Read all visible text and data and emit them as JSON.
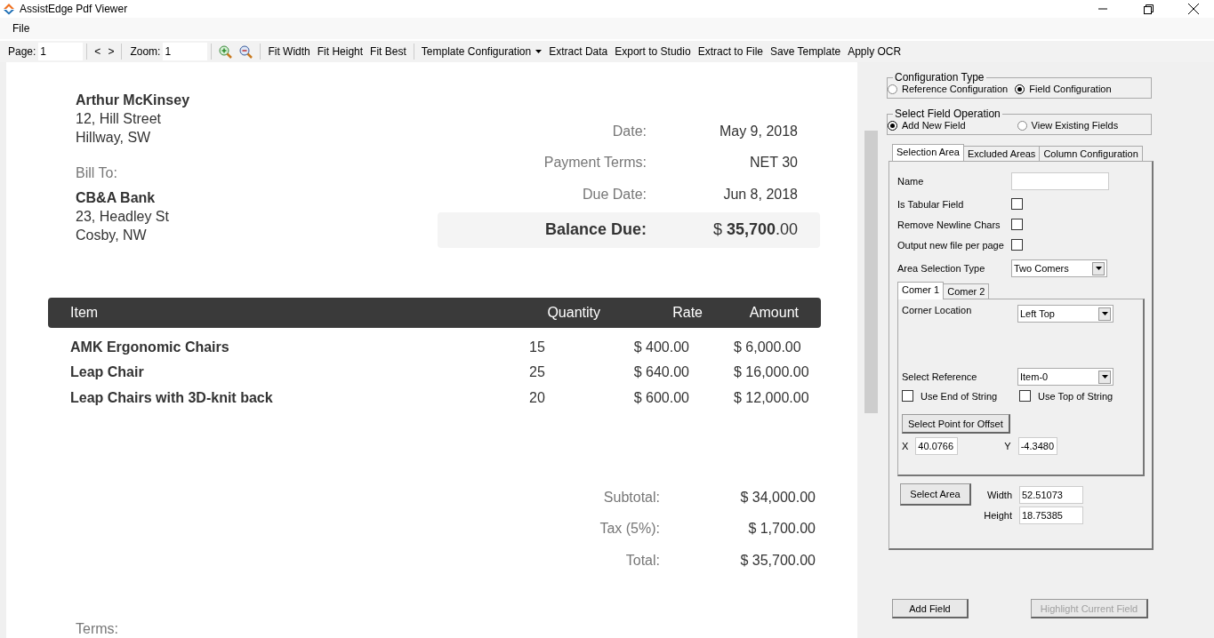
{
  "window": {
    "title": "AssistEdge Pdf Viewer"
  },
  "menu": [
    "File"
  ],
  "toolbar": {
    "page": {
      "label": "Page:",
      "value": "1"
    },
    "nav": [
      "<",
      ">"
    ],
    "zoom": {
      "label": "Zoom:",
      "value": "1"
    },
    "buttons": [
      {
        "label": "Fit Width",
        "kind": "plain"
      },
      {
        "label": "Fit Height",
        "kind": "plain"
      },
      {
        "label": "Fit Best",
        "kind": "plain"
      },
      {
        "label": "Template Configuration",
        "kind": "dropdown"
      },
      {
        "label": "Extract Data",
        "kind": "plain"
      },
      {
        "label": "Export to Studio",
        "kind": "plain"
      },
      {
        "label": "Extract to File",
        "kind": "plain"
      },
      {
        "label": "Save Template",
        "kind": "plain"
      },
      {
        "label": "Apply OCR",
        "kind": "plain"
      }
    ]
  },
  "invoice": {
    "from": {
      "name": "Arthur McKinsey",
      "lines": [
        "12, Hill Street",
        "Hillway, SW"
      ]
    },
    "bill_to_label": "Bill To:",
    "bill_to": {
      "name": "CB&A Bank",
      "lines": [
        "23, Headley St",
        "Cosby, NW"
      ]
    },
    "meta": [
      {
        "label": "Date:",
        "value": "May 9, 2018"
      },
      {
        "label": "Payment Terms:",
        "value": "NET 30"
      },
      {
        "label": "Due Date:",
        "value": "Jun 8, 2018"
      }
    ],
    "balance": {
      "label": "Balance Due:",
      "value": "$ **35,700**.00"
    },
    "columns": [
      "Item",
      "Quantity",
      "Rate",
      "Amount"
    ],
    "rows": [
      [
        "AMK Ergonomic Chairs",
        "15",
        "$ 400.00",
        "$ 6,000.00"
      ],
      [
        "Leap Chair",
        "25",
        "$ 640.00",
        "$ 16,000.00"
      ],
      [
        "Leap Chairs with 3D-knit back",
        "20",
        "$ 600.00",
        "$ 12,000.00"
      ]
    ],
    "totals": [
      {
        "label": "Subtotal:",
        "value": "$ 34,000.00"
      },
      {
        "label": "Tax (5%):",
        "value": "$ 1,700.00"
      },
      {
        "label": "Total:",
        "value": "$ 35,700.00"
      }
    ],
    "terms": "Terms:"
  },
  "panel": {
    "configuration_type": {
      "title": "Configuration Type",
      "options": [
        {
          "label": "Reference Configuration",
          "selected": false
        },
        {
          "label": "Field Configuration",
          "selected": true
        }
      ]
    },
    "field_operation": {
      "title": "Select Field Operation",
      "options": [
        {
          "label": "Add New Field",
          "selected": true
        },
        {
          "label": "View Existing Fields",
          "selected": false
        }
      ]
    },
    "tabs": [
      {
        "label": "Selection Area",
        "selected": true
      },
      {
        "label": "Excluded Areas",
        "selected": false
      },
      {
        "label": "Column Configuration",
        "selected": false
      }
    ],
    "name_label": "Name",
    "checks": [
      {
        "label": "Is Tabular Field",
        "checked": false
      },
      {
        "label": "Remove Newline Chars",
        "checked": false
      },
      {
        "label": "Output new file per page",
        "checked": false
      }
    ],
    "area_type": {
      "label": "Area Selection Type",
      "value": "Two Comers"
    },
    "corner_tabs": [
      {
        "label": "Comer 1",
        "selected": true
      },
      {
        "label": "Comer 2",
        "selected": false
      }
    ],
    "corner_location": {
      "label": "Corner Location",
      "value": "Left Top"
    },
    "reference": {
      "label": "Select Reference",
      "value": "Item-0"
    },
    "string_checks": [
      {
        "label": "Use End of String",
        "checked": false
      },
      {
        "label": "Use Top of String",
        "checked": false
      }
    ],
    "offset_button": "Select Point for Offset",
    "x": {
      "label": "X",
      "value": "40.0766"
    },
    "y": {
      "label": "Y",
      "value": "-4.3480"
    },
    "area_button": "Select Area",
    "width": {
      "label": "Width",
      "value": "52.51073"
    },
    "height": {
      "label": "Height",
      "value": "18.75385"
    },
    "add_button": {
      "label": "Add Field",
      "disabled": false
    },
    "highlight_button": {
      "label": "Highlight Current Field",
      "disabled": true
    }
  }
}
